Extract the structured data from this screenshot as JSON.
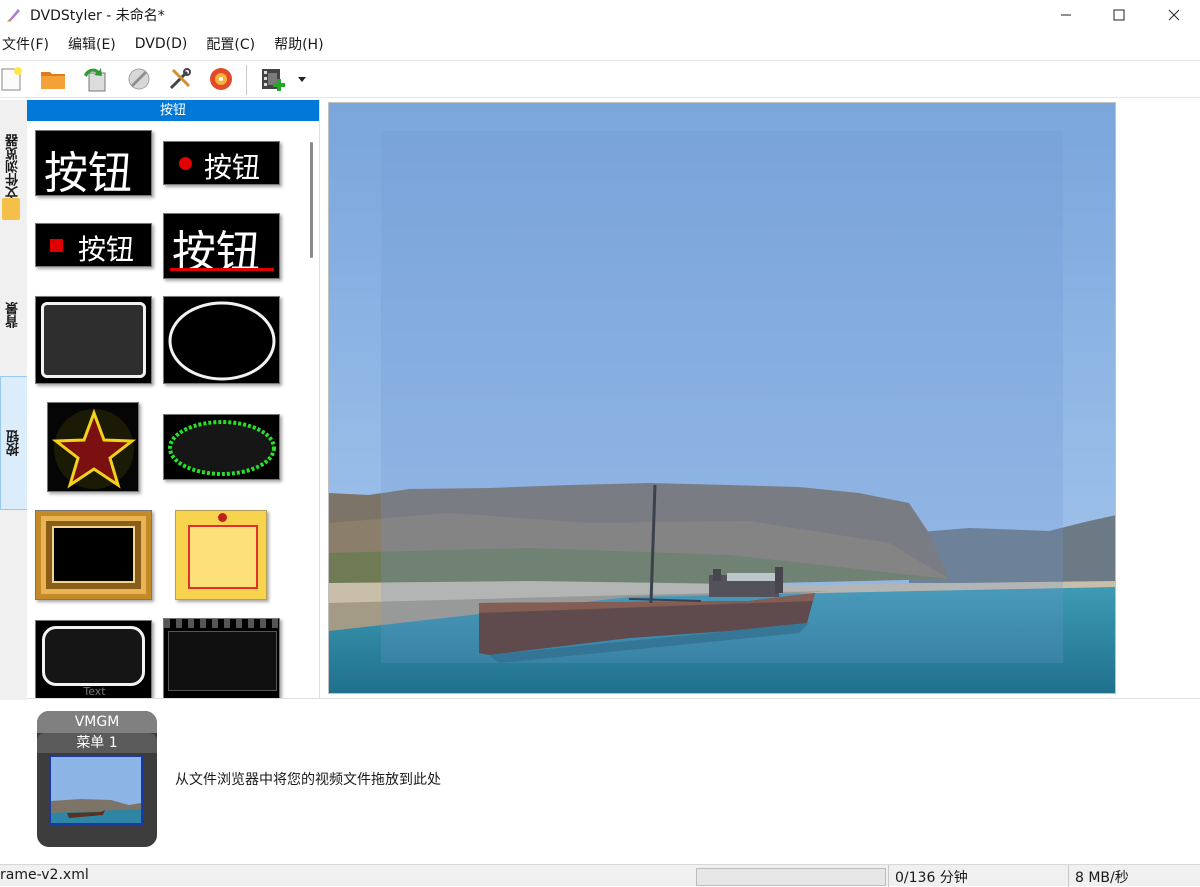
{
  "window": {
    "title": "DVDStyler - 未命名*",
    "controls": [
      "minimize",
      "maximize",
      "close"
    ]
  },
  "menubar": {
    "items": [
      "文件(F)",
      "编辑(E)",
      "DVD(D)",
      "配置(C)",
      "帮助(H)"
    ]
  },
  "toolbar": {
    "buttons": [
      "new-project-icon",
      "open-folder-icon",
      "save-icon",
      "run-wizard-icon",
      "settings-tools-icon",
      "burn-disc-icon",
      "add-video-icon",
      "dropdown-arrow-icon"
    ]
  },
  "side_tabs": [
    {
      "label": "文件浏览器",
      "active": false
    },
    {
      "label": "背景",
      "active": false
    },
    {
      "label": "按钮",
      "active": true
    }
  ],
  "button_panel": {
    "header": "按钮",
    "sample_text": "按钮",
    "small_text": "Text"
  },
  "titleset": {
    "vmgm_label": "VMGM",
    "menu_label": "菜单 1",
    "drop_hint": "从文件浏览器中将您的视频文件拖放到此处"
  },
  "status": {
    "file": "rame-v2.xml",
    "time": "0/136 分钟",
    "rate": "8 MB/秒"
  },
  "colors": {
    "accent": "#0078d7",
    "active_tab_bg": "#dbecfb"
  }
}
